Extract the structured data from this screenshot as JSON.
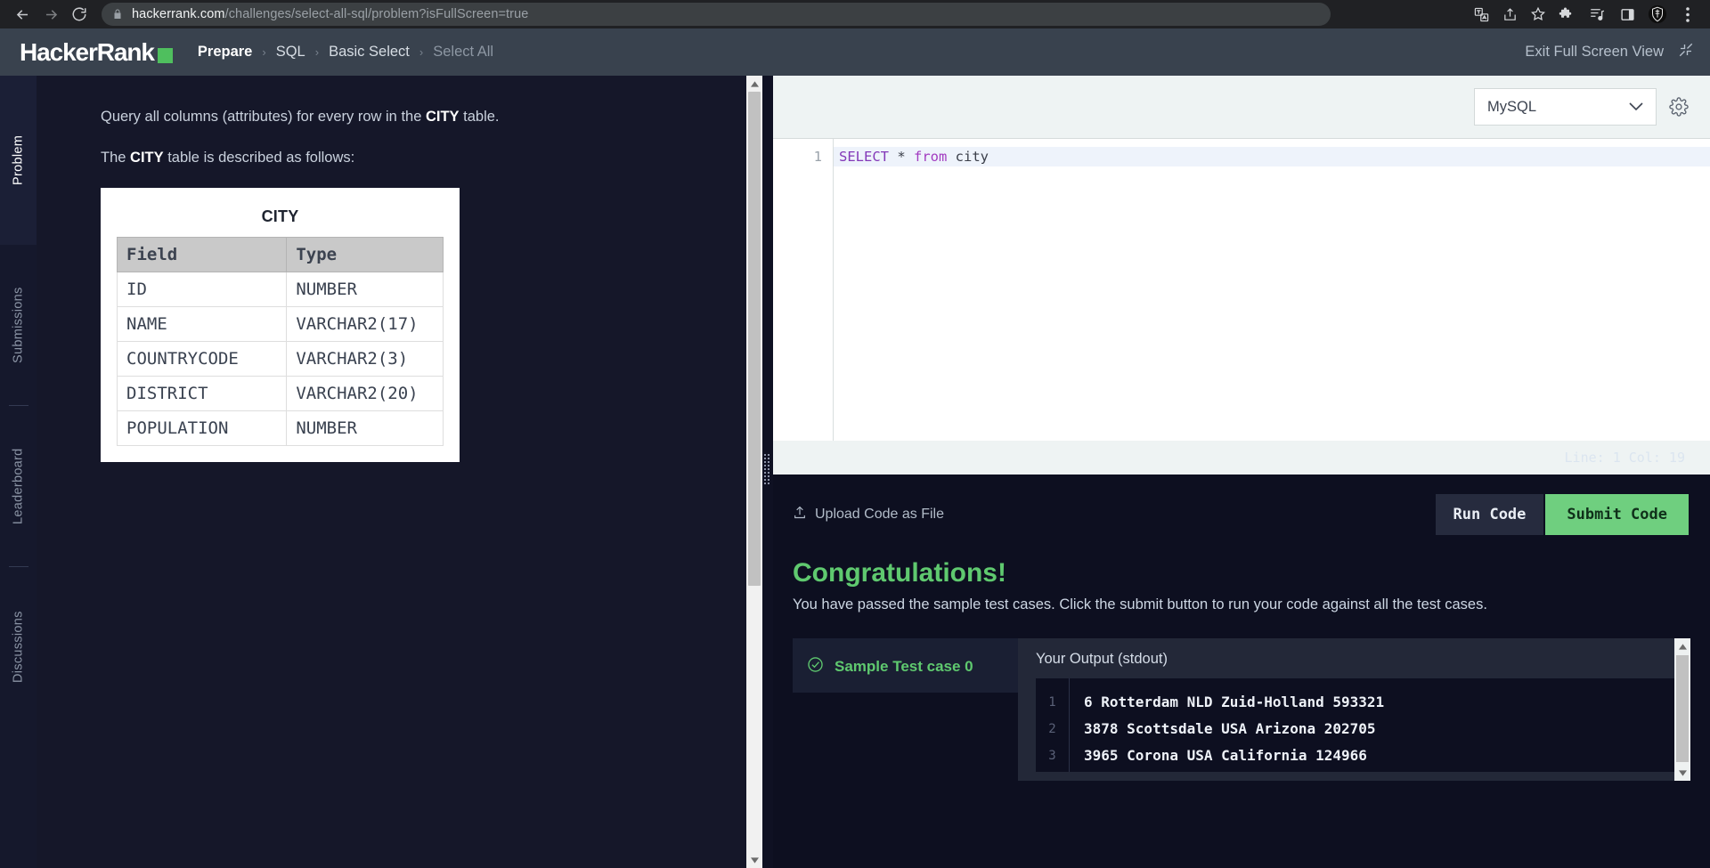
{
  "browser": {
    "url_host": "hackerrank.com",
    "url_path": "/challenges/select-all-sql/problem?isFullScreen=true",
    "nav": {
      "back": "back-arrow",
      "forward": "forward-arrow",
      "reload": "reload"
    },
    "icons": [
      "translate-icon",
      "share-icon",
      "bookmark-star-icon",
      "extensions-icon",
      "reading-list-icon",
      "sidebar-icon",
      "shield-extension-icon",
      "browser-menu-icon"
    ]
  },
  "header": {
    "logo_text": "HackerRank",
    "breadcrumb": [
      "Prepare",
      "SQL",
      "Basic Select",
      "Select All"
    ],
    "separator": "›",
    "exit_fullscreen": "Exit Full Screen View"
  },
  "rail": {
    "tabs": [
      "Problem",
      "Submissions",
      "Leaderboard",
      "Discussions"
    ],
    "active": "Problem"
  },
  "problem": {
    "line1_pre": "Query all columns (attributes) for every row in the ",
    "line1_bold": "CITY",
    "line1_post": " table.",
    "line2_pre": "The ",
    "line2_bold": "CITY",
    "line2_post": " table is described as follows:",
    "table": {
      "title": "CITY",
      "headers": [
        "Field",
        "Type"
      ],
      "rows": [
        [
          "ID",
          "NUMBER"
        ],
        [
          "NAME",
          "VARCHAR2(17)"
        ],
        [
          "COUNTRYCODE",
          "VARCHAR2(3)"
        ],
        [
          "DISTRICT",
          "VARCHAR2(20)"
        ],
        [
          "POPULATION",
          "NUMBER"
        ]
      ]
    }
  },
  "editor": {
    "language": "MySQL",
    "settings_icon": "gear-icon",
    "dropdown_icon": "chevron-down-icon",
    "line_number": "1",
    "code_tokens": {
      "kw": "SELECT",
      "op": " * ",
      "kw2": "from",
      "id": " city"
    },
    "status": "Line: 1 Col: 19"
  },
  "actions": {
    "upload_label": "Upload Code as File",
    "upload_icon": "upload-icon",
    "run_label": "Run Code",
    "submit_label": "Submit Code"
  },
  "result": {
    "heading": "Congratulations!",
    "subtext": "You have passed the sample test cases. Click the submit button to run your code against all the test cases.",
    "testcase_label": "Sample Test case 0",
    "testcase_icon": "check-circle-icon",
    "output_title": "Your Output (stdout)",
    "output_lines": [
      {
        "n": "1",
        "text": "6 Rotterdam NLD Zuid-Holland 593321"
      },
      {
        "n": "2",
        "text": "3878 Scottsdale USA Arizona 202705"
      },
      {
        "n": "3",
        "text": "3965 Corona USA California 124966"
      }
    ]
  },
  "colors": {
    "brand_green": "#4fbf5e",
    "submit_green": "#6fcf7f",
    "header_bg": "#39424e",
    "page_bg": "#0f1123"
  }
}
